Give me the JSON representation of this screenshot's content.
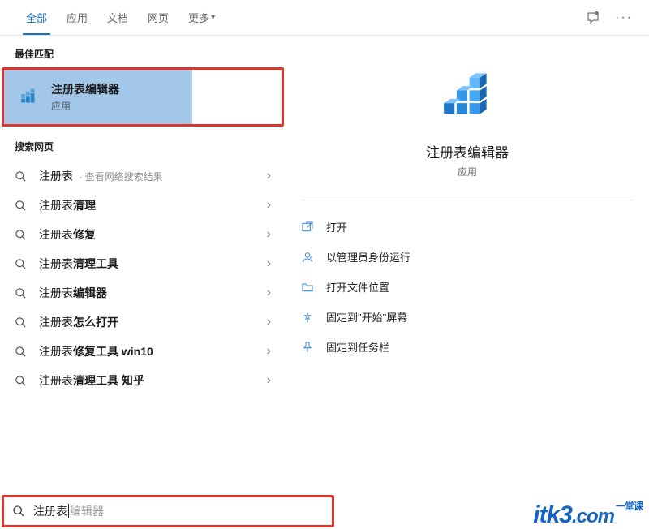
{
  "tabs": {
    "items": [
      "全部",
      "应用",
      "文档",
      "网页",
      "更多"
    ],
    "active_index": 0
  },
  "best_match": {
    "section_label": "最佳匹配",
    "title": "注册表编辑器",
    "subtitle": "应用"
  },
  "web_search": {
    "section_label": "搜索网页",
    "items": [
      {
        "prefix": "注册表",
        "bold": "",
        "sub": " - 查看网络搜索结果"
      },
      {
        "prefix": "注册表",
        "bold": "清理",
        "sub": ""
      },
      {
        "prefix": "注册表",
        "bold": "修复",
        "sub": ""
      },
      {
        "prefix": "注册表",
        "bold": "清理工具",
        "sub": ""
      },
      {
        "prefix": "注册表",
        "bold": "编辑器",
        "sub": ""
      },
      {
        "prefix": "注册表",
        "bold": "怎么打开",
        "sub": ""
      },
      {
        "prefix": "注册表",
        "bold": "修复工具 win10",
        "sub": ""
      },
      {
        "prefix": "注册表",
        "bold": "清理工具 知乎",
        "sub": ""
      }
    ]
  },
  "detail": {
    "title": "注册表编辑器",
    "subtitle": "应用",
    "actions": [
      {
        "icon": "open",
        "label": "打开"
      },
      {
        "icon": "admin",
        "label": "以管理员身份运行"
      },
      {
        "icon": "folder",
        "label": "打开文件位置"
      },
      {
        "icon": "pin-start",
        "label": "固定到\"开始\"屏幕"
      },
      {
        "icon": "pin-task",
        "label": "固定到任务栏"
      }
    ]
  },
  "search_input": {
    "typed": "注册表",
    "completion": "编辑器"
  },
  "watermark": {
    "main": "itk3",
    "dot": ".com",
    "tag": "一堂课"
  }
}
